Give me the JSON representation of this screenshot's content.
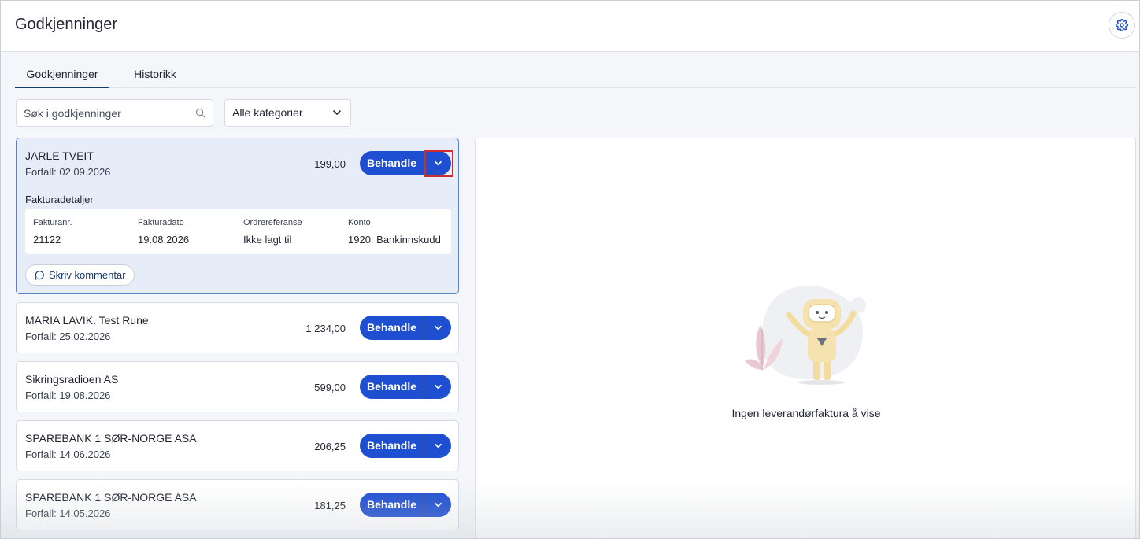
{
  "header": {
    "title": "Godkjenninger",
    "settings_icon": "gear-icon"
  },
  "tabs": [
    {
      "label": "Godkjenninger",
      "active": true
    },
    {
      "label": "Historikk",
      "active": false
    }
  ],
  "filters": {
    "search_placeholder": "Søk i godkjenninger",
    "category_value": "Alle kategorier"
  },
  "invoices": [
    {
      "vendor": "JARLE TVEIT",
      "due": "Forfall: 02.09.2026",
      "amount": "199,00",
      "action": "Behandle",
      "expanded": true
    },
    {
      "vendor": "MARIA LAVIK. Test Rune",
      "due": "Forfall: 25.02.2026",
      "amount": "1 234,00",
      "action": "Behandle"
    },
    {
      "vendor": "Sikringsradioen AS",
      "due": "Forfall: 19.08.2026",
      "amount": "599,00",
      "action": "Behandle"
    },
    {
      "vendor": "SPAREBANK 1 SØR-NORGE ASA",
      "due": "Forfall: 14.06.2026",
      "amount": "206,25",
      "action": "Behandle"
    },
    {
      "vendor": "SPAREBANK 1 SØR-NORGE ASA",
      "due": "Forfall: 14.05.2026",
      "amount": "181,25",
      "action": "Behandle"
    }
  ],
  "details": {
    "title": "Fakturadetaljer",
    "fields": [
      {
        "label": "Fakturanr.",
        "value": "21122"
      },
      {
        "label": "Fakturadato",
        "value": "19.08.2026"
      },
      {
        "label": "Ordrereferanse",
        "value": "Ikke lagt til"
      },
      {
        "label": "Konto",
        "value": "1920: Bankinnskudd"
      }
    ],
    "comment_label": "Skriv kommentar"
  },
  "empty_state": {
    "text": "Ingen leverandørfaktura å vise"
  },
  "colors": {
    "primary": "#1f4fd1",
    "selected_bg": "#e6edf9",
    "highlight": "#d12b2b"
  }
}
